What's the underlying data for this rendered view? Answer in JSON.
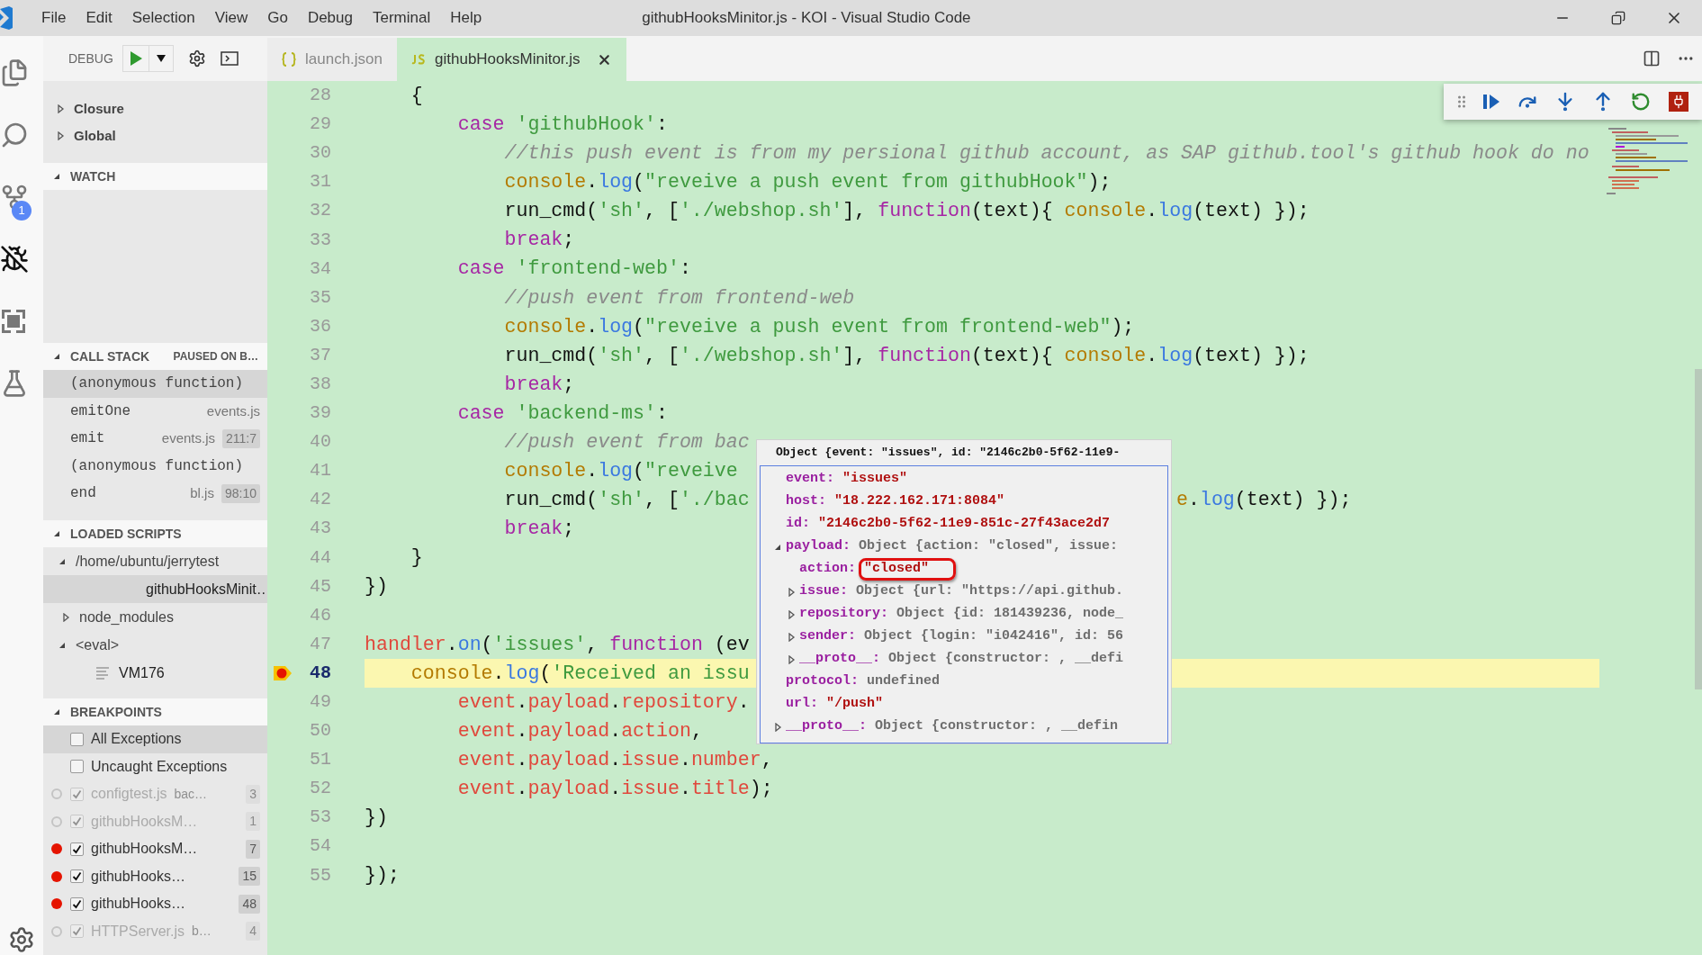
{
  "window": {
    "title": "githubHooksMinitor.js - KOI - Visual Studio Code"
  },
  "menu": [
    "File",
    "Edit",
    "Selection",
    "View",
    "Go",
    "Debug",
    "Terminal",
    "Help"
  ],
  "activity_bar": [
    {
      "kind": "files",
      "selected": false
    },
    {
      "kind": "search",
      "selected": false
    },
    {
      "kind": "source-control",
      "selected": false,
      "badge": "1"
    },
    {
      "kind": "debug",
      "selected": true
    },
    {
      "kind": "extensions",
      "selected": false
    },
    {
      "kind": "test",
      "selected": false
    }
  ],
  "debug_bar": {
    "label": "DEBUG"
  },
  "variables": [
    {
      "label": "Closure",
      "expanded": false
    },
    {
      "label": "Global",
      "expanded": false
    }
  ],
  "watch": {
    "title": "WATCH",
    "expanded": true
  },
  "call_stack": {
    "title": "CALL STACK",
    "status": "PAUSED ON B…",
    "expanded": true,
    "frames": [
      {
        "name": "(anonymous function)",
        "selected": true
      },
      {
        "name": "emitOne",
        "file": "events.js",
        "selected": false
      },
      {
        "name": "emit",
        "file": "events.js",
        "position": "211:7",
        "selected": false
      },
      {
        "name": "(anonymous function)",
        "selected": false
      },
      {
        "name": "end",
        "file": "bl.js",
        "position": "98:10",
        "selected": false
      }
    ]
  },
  "loaded_scripts": {
    "title": "LOADED SCRIPTS",
    "expanded": true,
    "items": [
      {
        "label": "/home/ubuntu/jerrytest",
        "expanded": true,
        "selected": false,
        "children": [
          {
            "kind": "js",
            "label": "githubHooksMinit…",
            "selected": true
          }
        ]
      },
      {
        "label": "node_modules",
        "expanded": false,
        "selected": false
      },
      {
        "label": "<eval>",
        "expanded": true,
        "selected": false,
        "children": [
          {
            "kind": "file",
            "label": "VM176",
            "selected": false
          }
        ]
      }
    ]
  },
  "breakpoints": {
    "title": "BREAKPOINTS",
    "expanded": true,
    "items": [
      {
        "kind": "exception",
        "label": "All Exceptions",
        "checked": false,
        "selected": true
      },
      {
        "kind": "exception",
        "label": "Uncaught Exceptions",
        "checked": false,
        "selected": false
      },
      {
        "kind": "file",
        "label": "configtest.js",
        "detail": "bac…",
        "line": "3",
        "checked": true,
        "enabled": false,
        "selected": false
      },
      {
        "kind": "file",
        "label": "githubHooksM…",
        "line": "1",
        "checked": true,
        "enabled": false,
        "selected": false
      },
      {
        "kind": "file",
        "label": "githubHooksM…",
        "line": "7",
        "checked": true,
        "enabled": true,
        "selected": false
      },
      {
        "kind": "file",
        "label": "githubHooks…",
        "line": "15",
        "checked": true,
        "enabled": true,
        "selected": false
      },
      {
        "kind": "file",
        "label": "githubHooks…",
        "line": "48",
        "checked": true,
        "enabled": true,
        "selected": false
      },
      {
        "kind": "file",
        "label": "HTTPServer.js",
        "detail": "b…",
        "line": "4",
        "checked": true,
        "enabled": false,
        "selected": false
      }
    ]
  },
  "tabs": [
    {
      "label": "launch.json",
      "kind": "json",
      "selected": false
    },
    {
      "label": "githubHooksMinitor.js",
      "kind": "js",
      "selected": true
    }
  ],
  "editor": {
    "lines": [
      {
        "number": "28",
        "current": false,
        "breakpoint": false,
        "tokens": [
          {
            "kind": "plain",
            "text": "    {"
          }
        ]
      },
      {
        "number": "29",
        "current": false,
        "breakpoint": false,
        "tokens": [
          {
            "kind": "kw",
            "text": "        case"
          },
          {
            "kind": "str",
            "text": " 'githubHook'"
          },
          {
            "kind": "plain",
            "text": ":"
          }
        ]
      },
      {
        "number": "30",
        "current": false,
        "breakpoint": false,
        "tokens": [
          {
            "kind": "cmt",
            "text": "            //this push event is from my persional github account, as SAP github.tool's github hook do no"
          }
        ]
      },
      {
        "number": "31",
        "current": false,
        "breakpoint": false,
        "tokens": [
          {
            "kind": "obj",
            "text": "            console"
          },
          {
            "kind": "plain",
            "text": "."
          },
          {
            "kind": "mth",
            "text": "log"
          },
          {
            "kind": "plain",
            "text": "("
          },
          {
            "kind": "str",
            "text": "\"reveive a push event from githubHook\""
          },
          {
            "kind": "plain",
            "text": ");"
          }
        ]
      },
      {
        "number": "32",
        "current": false,
        "breakpoint": false,
        "tokens": [
          {
            "kind": "plain",
            "text": "            run_cmd("
          },
          {
            "kind": "str",
            "text": "'sh'"
          },
          {
            "kind": "plain",
            "text": ", ["
          },
          {
            "kind": "str",
            "text": "'./webshop.sh'"
          },
          {
            "kind": "plain",
            "text": "], "
          },
          {
            "kind": "kw",
            "text": "function"
          },
          {
            "kind": "plain",
            "text": "(text){ "
          },
          {
            "kind": "obj",
            "text": "console"
          },
          {
            "kind": "plain",
            "text": "."
          },
          {
            "kind": "mth",
            "text": "log"
          },
          {
            "kind": "plain",
            "text": "(text) });"
          }
        ]
      },
      {
        "number": "33",
        "current": false,
        "breakpoint": false,
        "tokens": [
          {
            "kind": "kw",
            "text": "            break"
          },
          {
            "kind": "plain",
            "text": ";"
          }
        ]
      },
      {
        "number": "34",
        "current": false,
        "breakpoint": false,
        "tokens": [
          {
            "kind": "kw",
            "text": "        case"
          },
          {
            "kind": "str",
            "text": " 'frontend-web'"
          },
          {
            "kind": "plain",
            "text": ":"
          }
        ]
      },
      {
        "number": "35",
        "current": false,
        "breakpoint": false,
        "tokens": [
          {
            "kind": "cmt",
            "text": "            //push event from frontend-web"
          }
        ]
      },
      {
        "number": "36",
        "current": false,
        "breakpoint": false,
        "tokens": [
          {
            "kind": "obj",
            "text": "            console"
          },
          {
            "kind": "plain",
            "text": "."
          },
          {
            "kind": "mth",
            "text": "log"
          },
          {
            "kind": "plain",
            "text": "("
          },
          {
            "kind": "str",
            "text": "\"reveive a push event from frontend-web\""
          },
          {
            "kind": "plain",
            "text": ");"
          }
        ]
      },
      {
        "number": "37",
        "current": false,
        "breakpoint": false,
        "tokens": [
          {
            "kind": "plain",
            "text": "            run_cmd("
          },
          {
            "kind": "str",
            "text": "'sh'"
          },
          {
            "kind": "plain",
            "text": ", ["
          },
          {
            "kind": "str",
            "text": "'./webshop.sh'"
          },
          {
            "kind": "plain",
            "text": "], "
          },
          {
            "kind": "kw",
            "text": "function"
          },
          {
            "kind": "plain",
            "text": "(text){ "
          },
          {
            "kind": "obj",
            "text": "console"
          },
          {
            "kind": "plain",
            "text": "."
          },
          {
            "kind": "mth",
            "text": "log"
          },
          {
            "kind": "plain",
            "text": "(text) });"
          }
        ]
      },
      {
        "number": "38",
        "current": false,
        "breakpoint": false,
        "tokens": [
          {
            "kind": "kw",
            "text": "            break"
          },
          {
            "kind": "plain",
            "text": ";"
          }
        ]
      },
      {
        "number": "39",
        "current": false,
        "breakpoint": false,
        "tokens": [
          {
            "kind": "kw",
            "text": "        case"
          },
          {
            "kind": "str",
            "text": " 'backend-ms'"
          },
          {
            "kind": "plain",
            "text": ":"
          }
        ]
      },
      {
        "number": "40",
        "current": false,
        "breakpoint": false,
        "tokens": [
          {
            "kind": "cmt",
            "text": "            //push event from bac"
          }
        ]
      },
      {
        "number": "41",
        "current": false,
        "breakpoint": false,
        "tokens": [
          {
            "kind": "obj",
            "text": "            console"
          },
          {
            "kind": "plain",
            "text": "."
          },
          {
            "kind": "mth",
            "text": "log"
          },
          {
            "kind": "plain",
            "text": "("
          },
          {
            "kind": "str",
            "text": "\"reveive"
          }
        ]
      },
      {
        "number": "42",
        "current": false,
        "breakpoint": false,
        "tokens": [
          {
            "kind": "plain",
            "text": "            run_cmd("
          },
          {
            "kind": "str",
            "text": "'sh'"
          },
          {
            "kind": "plain",
            "text": ", ["
          },
          {
            "kind": "str",
            "text": "'./bac"
          }
        ],
        "tail": [
          {
            "kind": "obj",
            "text": "e"
          },
          {
            "kind": "plain",
            "text": "."
          },
          {
            "kind": "mth",
            "text": "log"
          },
          {
            "kind": "plain",
            "text": "(text) });"
          }
        ]
      },
      {
        "number": "43",
        "current": false,
        "breakpoint": false,
        "tokens": [
          {
            "kind": "kw",
            "text": "            break"
          },
          {
            "kind": "plain",
            "text": ";"
          }
        ]
      },
      {
        "number": "44",
        "current": false,
        "breakpoint": false,
        "tokens": [
          {
            "kind": "plain",
            "text": "    }"
          }
        ]
      },
      {
        "number": "45",
        "current": false,
        "breakpoint": false,
        "tokens": [
          {
            "kind": "plain",
            "text": "})"
          }
        ]
      },
      {
        "number": "46",
        "current": false,
        "breakpoint": false
      },
      {
        "number": "47",
        "current": false,
        "breakpoint": false,
        "tokens": [
          {
            "kind": "var",
            "text": "handler"
          },
          {
            "kind": "plain",
            "text": "."
          },
          {
            "kind": "mth",
            "text": "on"
          },
          {
            "kind": "plain",
            "text": "("
          },
          {
            "kind": "str",
            "text": "'issues'"
          },
          {
            "kind": "plain",
            "text": ", "
          },
          {
            "kind": "kw",
            "text": "function"
          },
          {
            "kind": "plain",
            "text": " (ev"
          }
        ]
      },
      {
        "number": "48",
        "current": true,
        "breakpoint": true,
        "tokens": [
          {
            "kind": "obj",
            "text": "    console"
          },
          {
            "kind": "plain",
            "text": "."
          },
          {
            "kind": "mth",
            "text": "log"
          },
          {
            "kind": "plain",
            "text": "("
          },
          {
            "kind": "str",
            "text": "'Received an issu"
          }
        ]
      },
      {
        "number": "49",
        "current": false,
        "breakpoint": false,
        "tokens": [
          {
            "kind": "var",
            "text": "        event"
          },
          {
            "kind": "plain",
            "text": "."
          },
          {
            "kind": "var",
            "text": "payload"
          },
          {
            "kind": "plain",
            "text": "."
          },
          {
            "kind": "var",
            "text": "repository"
          },
          {
            "kind": "plain",
            "text": "."
          }
        ]
      },
      {
        "number": "50",
        "current": false,
        "breakpoint": false,
        "tokens": [
          {
            "kind": "var",
            "text": "        event"
          },
          {
            "kind": "plain",
            "text": "."
          },
          {
            "kind": "var",
            "text": "payload"
          },
          {
            "kind": "plain",
            "text": "."
          },
          {
            "kind": "var",
            "text": "action"
          },
          {
            "kind": "plain",
            "text": ","
          }
        ]
      },
      {
        "number": "51",
        "current": false,
        "breakpoint": false,
        "tokens": [
          {
            "kind": "var",
            "text": "        event"
          },
          {
            "kind": "plain",
            "text": "."
          },
          {
            "kind": "var",
            "text": "payload"
          },
          {
            "kind": "plain",
            "text": "."
          },
          {
            "kind": "var",
            "text": "issue"
          },
          {
            "kind": "plain",
            "text": "."
          },
          {
            "kind": "var",
            "text": "number"
          },
          {
            "kind": "plain",
            "text": ","
          }
        ]
      },
      {
        "number": "52",
        "current": false,
        "breakpoint": false,
        "tokens": [
          {
            "kind": "var",
            "text": "        event"
          },
          {
            "kind": "plain",
            "text": "."
          },
          {
            "kind": "var",
            "text": "payload"
          },
          {
            "kind": "plain",
            "text": "."
          },
          {
            "kind": "var",
            "text": "issue"
          },
          {
            "kind": "plain",
            "text": "."
          },
          {
            "kind": "var",
            "text": "title"
          },
          {
            "kind": "plain",
            "text": ");"
          }
        ]
      },
      {
        "number": "53",
        "current": false,
        "breakpoint": false,
        "tokens": [
          {
            "kind": "plain",
            "text": "})"
          }
        ]
      },
      {
        "number": "54",
        "current": false,
        "breakpoint": false
      },
      {
        "number": "55",
        "current": false,
        "breakpoint": false,
        "tokens": [
          {
            "kind": "plain",
            "text": "});"
          }
        ]
      }
    ],
    "hover": {
      "header": "Object {event: \"issues\", id: \"2146c2b0-5f62-11e9-",
      "rows": [
        {
          "key": "event:",
          "value": "\"issues\"",
          "kind": "string",
          "circled": false
        },
        {
          "key": "host:",
          "value": "\"18.222.162.171:8084\"",
          "kind": "string",
          "circled": false
        },
        {
          "key": "id:",
          "value": "\"2146c2b0-5f62-11e9-851c-27f43ace2d7",
          "kind": "string",
          "circled": false
        },
        {
          "key": "payload:",
          "value": "Object {action: \"closed\", issue:",
          "kind": "object",
          "circled": false,
          "expanded": true,
          "children": [
            {
              "key": "action:",
              "value": "\"closed\"",
              "kind": "string",
              "circled": true
            },
            {
              "key": "issue:",
              "value": "Object {url: \"https://api.github.",
              "kind": "object",
              "circled": false,
              "expanded": false
            },
            {
              "key": "repository:",
              "value": "Object {id: 181439236, node_",
              "kind": "object",
              "circled": false,
              "expanded": false
            },
            {
              "key": "sender:",
              "value": "Object {login: \"i042416\", id: 56",
              "kind": "object",
              "circled": false,
              "expanded": false
            },
            {
              "key": "__proto__:",
              "value": "Object {constructor: , __defi",
              "kind": "object",
              "circled": false,
              "expanded": false
            }
          ]
        },
        {
          "key": "protocol:",
          "value": "undefined",
          "kind": "object",
          "circled": false
        },
        {
          "key": "url:",
          "value": "\"/push\"",
          "kind": "string",
          "circled": false
        },
        {
          "key": "__proto__:",
          "value": "Object {constructor: , __defin",
          "kind": "object",
          "circled": false,
          "expanded": false
        }
      ]
    }
  }
}
